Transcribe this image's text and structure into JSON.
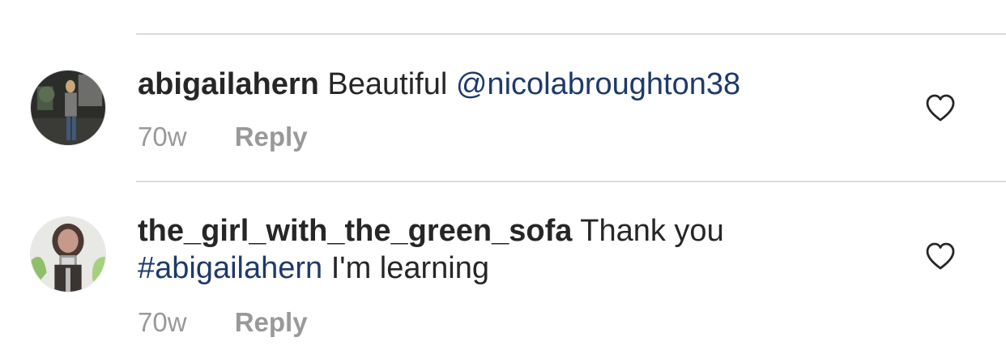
{
  "comments": [
    {
      "username": "abigailahern",
      "text": "Beautiful",
      "mention": "@nicolabroughton38",
      "time": "70w",
      "reply_label": "Reply",
      "like_icon": "heart-outline-icon"
    },
    {
      "username": "the_girl_with_the_green_sofa",
      "text_line1": "Thank you",
      "hashtag": "#abigailahern",
      "text_line2": "I'm learning",
      "time": "70w",
      "reply_label": "Reply",
      "like_icon": "heart-outline-icon"
    }
  ],
  "colors": {
    "link": "#1e3a6b",
    "meta": "#999999",
    "divider": "#dbdbdb",
    "text": "#262626"
  }
}
